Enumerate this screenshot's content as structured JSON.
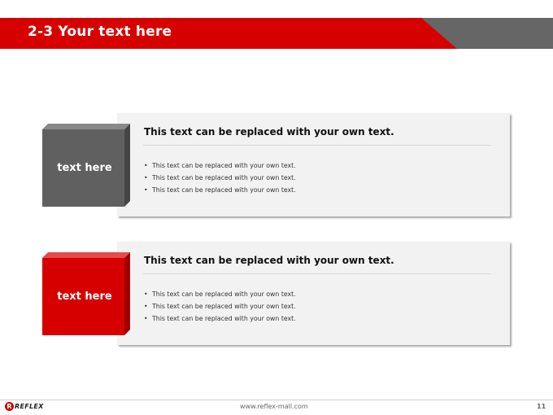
{
  "header": {
    "title": "2-3 Your text here"
  },
  "sections": [
    {
      "label": "text here",
      "heading": "This text can be replaced with your own text.",
      "bullets": [
        "This text can be replaced with your own text.",
        "This text can be replaced with your own text.",
        "This text can be replaced with your own text."
      ],
      "color": "#606060"
    },
    {
      "label": "text here",
      "heading": "This text can be replaced with your own text.",
      "bullets": [
        "This text can be replaced with your own text.",
        "This text can be replaced with your own text.",
        "This text can be replaced with your own text."
      ],
      "color": "#d60000"
    }
  ],
  "footer": {
    "logo_text": "REFLEX",
    "logo_letter": "R",
    "url": "www.reflex-mall.com",
    "page_number": "11"
  },
  "colors": {
    "accent_red": "#d60000",
    "dark_gray": "#606060",
    "panel_bg": "#f2f2f2"
  }
}
